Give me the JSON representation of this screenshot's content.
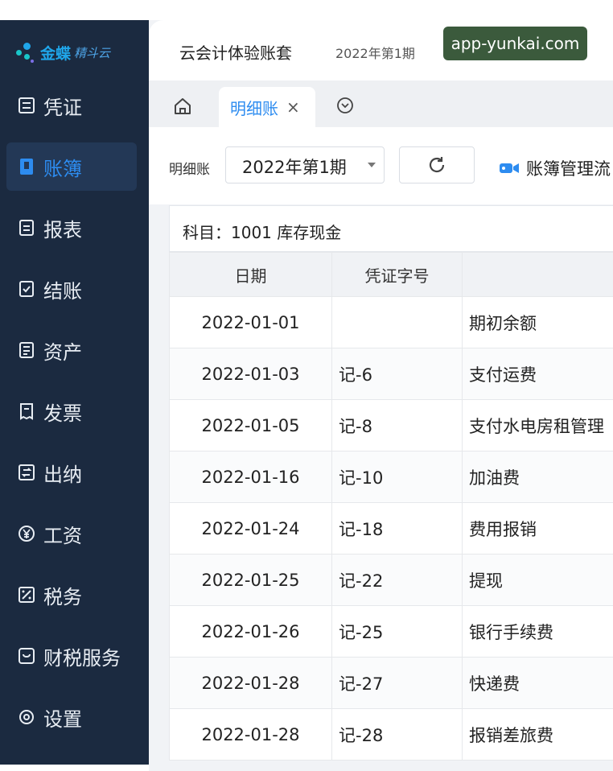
{
  "sidebar": {
    "logo": {
      "brand": "金蝶",
      "product": "精斗云"
    },
    "items": [
      {
        "label": "凭证",
        "icon": "voucher-icon",
        "active": false
      },
      {
        "label": "账簿",
        "icon": "ledger-book-icon",
        "active": true
      },
      {
        "label": "报表",
        "icon": "report-icon",
        "active": false
      },
      {
        "label": "结账",
        "icon": "closing-icon",
        "active": false
      },
      {
        "label": "资产",
        "icon": "asset-icon",
        "active": false
      },
      {
        "label": "发票",
        "icon": "invoice-icon",
        "active": false
      },
      {
        "label": "出纳",
        "icon": "cashier-icon",
        "active": false
      },
      {
        "label": "工资",
        "icon": "yen-icon",
        "active": false
      },
      {
        "label": "税务",
        "icon": "tax-icon",
        "active": false
      },
      {
        "label": "财税服务",
        "icon": "service-icon",
        "active": false
      },
      {
        "label": "设置",
        "icon": "settings-icon",
        "active": false
      }
    ]
  },
  "header": {
    "account_name": "云会计体验账套",
    "period": "2022年第1期",
    "watermark": "app-yunkai.com"
  },
  "tabs": [
    {
      "label": "明细账",
      "active": true
    }
  ],
  "toolbar": {
    "label": "明细账",
    "period_value": "2022年第1期",
    "flow_link": "账簿管理流"
  },
  "subject": "科目：1001 库存现金",
  "table": {
    "columns": [
      "日期",
      "凭证字号",
      ""
    ],
    "rows": [
      {
        "date": "2022-01-01",
        "voucher": "",
        "summary": "期初余额"
      },
      {
        "date": "2022-01-03",
        "voucher": "记-6",
        "summary": "支付运费"
      },
      {
        "date": "2022-01-05",
        "voucher": "记-8",
        "summary": "支付水电房租管理"
      },
      {
        "date": "2022-01-16",
        "voucher": "记-10",
        "summary": "加油费"
      },
      {
        "date": "2022-01-24",
        "voucher": "记-18",
        "summary": "费用报销"
      },
      {
        "date": "2022-01-25",
        "voucher": "记-22",
        "summary": "提现"
      },
      {
        "date": "2022-01-26",
        "voucher": "记-25",
        "summary": "银行手续费"
      },
      {
        "date": "2022-01-28",
        "voucher": "记-27",
        "summary": "快递费"
      },
      {
        "date": "2022-01-28",
        "voucher": "记-28",
        "summary": "报销差旅费"
      }
    ]
  },
  "colors": {
    "sidebar_bg": "#1b2a40",
    "accent": "#2d8cf0",
    "watermark_bg": "#3b5a3c"
  }
}
